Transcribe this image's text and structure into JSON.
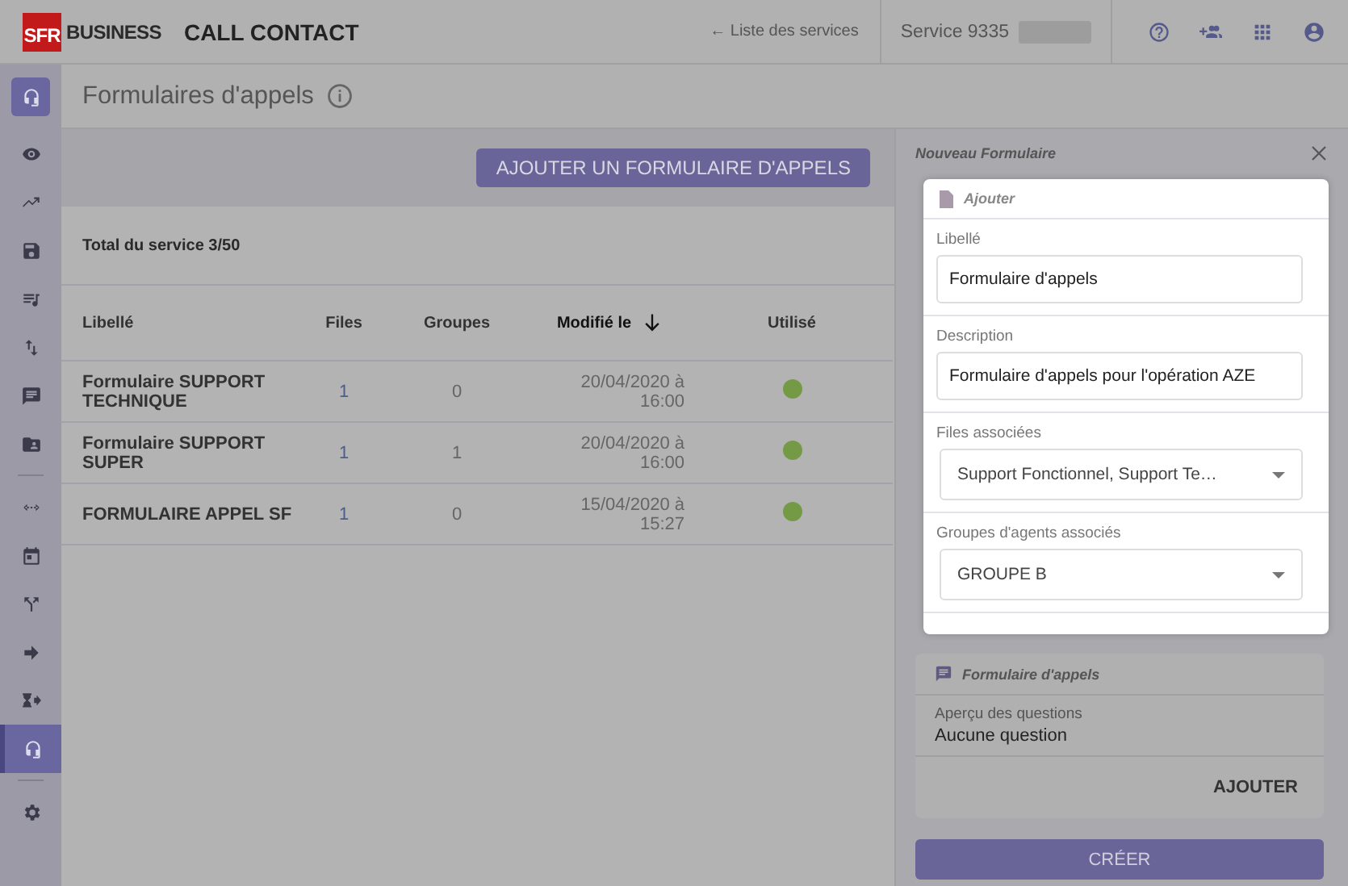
{
  "header": {
    "logo": "SFR",
    "brand": "BUSINESS",
    "app_title": "CALL CONTACT",
    "services_link": "← Liste des services",
    "service": "Service 9335"
  },
  "sidebar": {
    "items": [
      {
        "selected": false
      },
      {
        "selected": false
      },
      {
        "selected": false
      },
      {
        "selected": false
      },
      {
        "selected": false
      },
      {
        "selected": false
      },
      {
        "selected": false
      },
      {
        "selected": false
      },
      {
        "selected": false
      },
      {
        "selected": false
      },
      {
        "selected": false
      },
      {
        "selected": false
      },
      {
        "selected": false
      },
      {
        "selected": true
      },
      {
        "selected": false
      }
    ]
  },
  "page_title": "Formulaires d'appels",
  "add_button": "AJOUTER UN FORMULAIRE D'APPELS",
  "total": "Total du service 3/50",
  "table": {
    "columns": [
      {
        "label": "Libellé",
        "sorted": false
      },
      {
        "label": "Files",
        "sorted": false
      },
      {
        "label": "Groupes",
        "sorted": false
      },
      {
        "label": "Modifié le",
        "sorted": true
      },
      {
        "label": "Utilisé",
        "sorted": false
      }
    ],
    "rows": [
      {
        "name": "Formulaire SUPPORT TECHNIQUE",
        "files": "1",
        "groups": "0",
        "date": "20/04/2020 à",
        "time": "16:00",
        "used": true
      },
      {
        "name": "Formulaire SUPPORT SUPER",
        "files": "1",
        "groups": "1",
        "date": "20/04/2020 à",
        "time": "16:00",
        "used": true
      },
      {
        "name": "FORMULAIRE APPEL SF",
        "files": "1",
        "groups": "0",
        "date": "15/04/2020 à",
        "time": "15:27",
        "used": true
      }
    ]
  },
  "panel": {
    "title": "Nouveau Formulaire",
    "form": {
      "header": "Ajouter",
      "fields": [
        {
          "kind": "input",
          "label": "Libellé",
          "value": "Formulaire d'appels"
        },
        {
          "kind": "input",
          "label": "Description",
          "value": "Formulaire d'appels pour l'opération AZE"
        },
        {
          "kind": "select",
          "label": "Files associées",
          "value": "Support Fonctionnel, Support Te…"
        },
        {
          "kind": "select",
          "label": "Groupes d'agents associés",
          "value": "GROUPE B"
        }
      ]
    },
    "questions": {
      "header": "Formulaire d'appels",
      "label": "Aperçu des questions",
      "value": "Aucune question",
      "button": "AJOUTER"
    },
    "create_button": "CRÉER"
  }
}
